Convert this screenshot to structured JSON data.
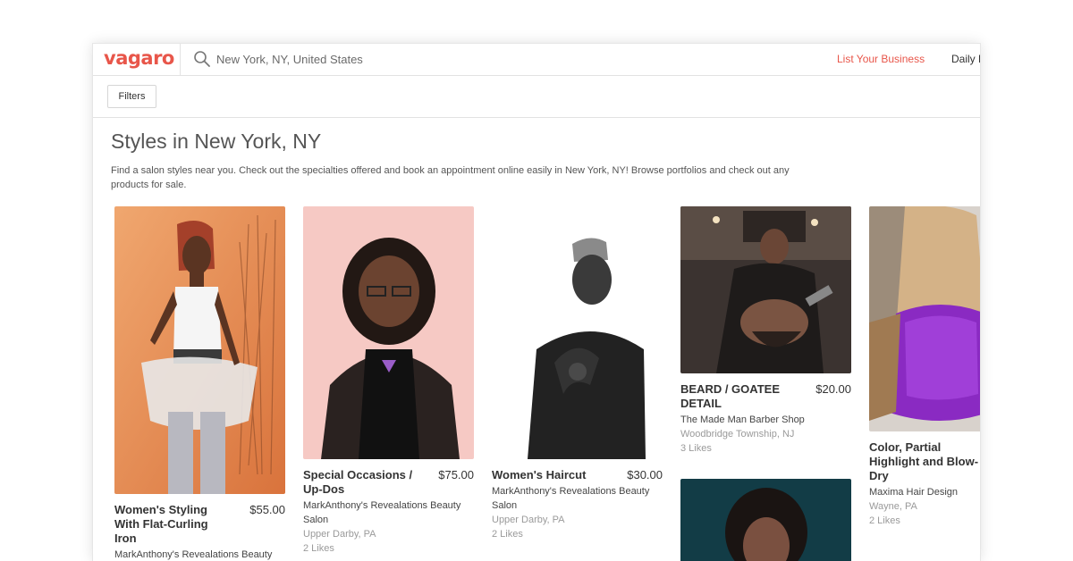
{
  "header": {
    "logo": "vagaro",
    "search_value": "New York, NY, United States",
    "list_business": "List Your Business",
    "daily": "Daily D"
  },
  "filters_label": "Filters",
  "page": {
    "title": "Styles in New York, NY",
    "description": "Find a salon styles near you. Check out the specialties offered and book an appointment online easily in New York, NY! Browse portfolios and check out any products for sale."
  },
  "cards": [
    {
      "title": "Women's Styling With Flat-Curling Iron",
      "price": "$55.00",
      "salon": "MarkAnthony's Revealations Beauty",
      "location": "",
      "likes": ""
    },
    {
      "title": "Special Occasions / Up-Dos",
      "price": "$75.00",
      "salon": "MarkAnthony's Revealations Beauty Salon",
      "location": "Upper Darby, PA",
      "likes": "2 Likes"
    },
    {
      "title": "Women's Haircut",
      "price": "$30.00",
      "salon": "MarkAnthony's Revealations Beauty Salon",
      "location": "Upper Darby, PA",
      "likes": "2 Likes"
    },
    {
      "title": "BEARD / GOATEE DETAIL",
      "price": "$20.00",
      "salon": "The Made Man Barber Shop",
      "location": "Woodbridge Township, NJ",
      "likes": "3 Likes"
    },
    {
      "title": "Color, Partial Highlight and Blow-Dry",
      "price": "",
      "salon": "Maxima Hair Design",
      "location": "Wayne, PA",
      "likes": "2 Likes"
    }
  ],
  "colors": {
    "brand": "#e8564a",
    "text": "#333333",
    "muted": "#9a9a9a"
  }
}
